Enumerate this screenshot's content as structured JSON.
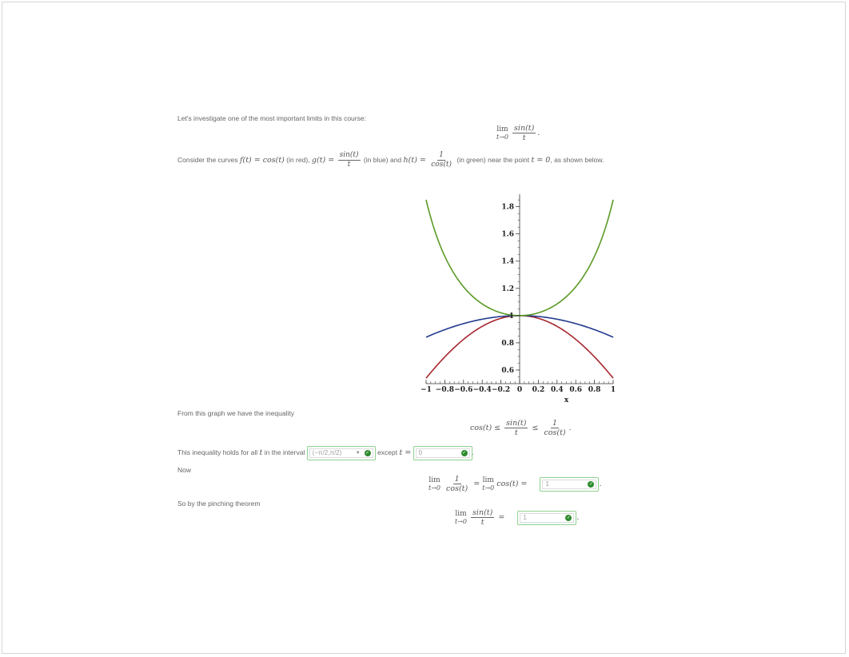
{
  "intro": "Let's investigate one of the most important limits in this course:",
  "consider": {
    "lead": "Consider the curves",
    "f_expr": "f(t) = cos(t)",
    "f_note": "(in red),",
    "g_lhs": "g(t) =",
    "g_num": "sin(t)",
    "g_den": "t",
    "g_note": "(in blue) and",
    "h_lhs": "h(t) =",
    "h_num": "1",
    "h_den": "cos(t)",
    "h_note": "(in green) near the point",
    "point": "t = 0",
    "tail": ", as shown below."
  },
  "main_limit": {
    "lim": "lim",
    "sub": "t→0",
    "num": "sin(t)",
    "den": "t"
  },
  "chart_data": {
    "type": "line",
    "x_axis": {
      "label": "x",
      "range": [
        -1,
        1
      ],
      "ticks": [
        "−1",
        "−0.8",
        "−0.6",
        "−0.4",
        "−0.2",
        "0",
        "0.2",
        "0.4",
        "0.6",
        "0.8",
        "1"
      ],
      "tick_values": [
        -1,
        -0.8,
        -0.6,
        -0.4,
        -0.2,
        0,
        0.2,
        0.4,
        0.6,
        0.8,
        1
      ]
    },
    "y_axis": {
      "range": [
        0.5,
        1.88
      ],
      "ticks": [
        "0.6",
        "0.8",
        "1",
        "1.2",
        "1.4",
        "1.6",
        "1.8"
      ],
      "tick_values": [
        0.6,
        0.8,
        1,
        1.2,
        1.4,
        1.6,
        1.8
      ]
    },
    "series": [
      {
        "function": "cos(t)",
        "color": "#a6262e"
      },
      {
        "function": "sin(t)/t",
        "color": "#233b8f"
      },
      {
        "function": "1/cos(t)",
        "color": "#5b9a25"
      }
    ]
  },
  "graph_text": "From this graph we have the inequality",
  "inequality": {
    "left": "cos(t) ≤",
    "num": "sin(t)",
    "den": "t",
    "mid": "≤",
    "num2": "1",
    "den2": "cos(t)"
  },
  "holds": {
    "lead": "This inequality holds for all",
    "var": "t",
    "in": "in the interval",
    "interval_value": "(−π/2,π/2)",
    "except": "except",
    "except_eq": "t =",
    "except_value": "0"
  },
  "now_label": "Now",
  "now_eq": {
    "lim": "lim",
    "sub": "t→0",
    "num": "1",
    "den": "cos(t)",
    "eq1": "=",
    "rhs": "cos(t) =",
    "value": "1"
  },
  "pinch_label": "So by the pinching theorem",
  "pinch_eq": {
    "lim": "lim",
    "sub": "t→0",
    "num": "sin(t)",
    "den": "t",
    "eq": "=",
    "value": "1"
  }
}
